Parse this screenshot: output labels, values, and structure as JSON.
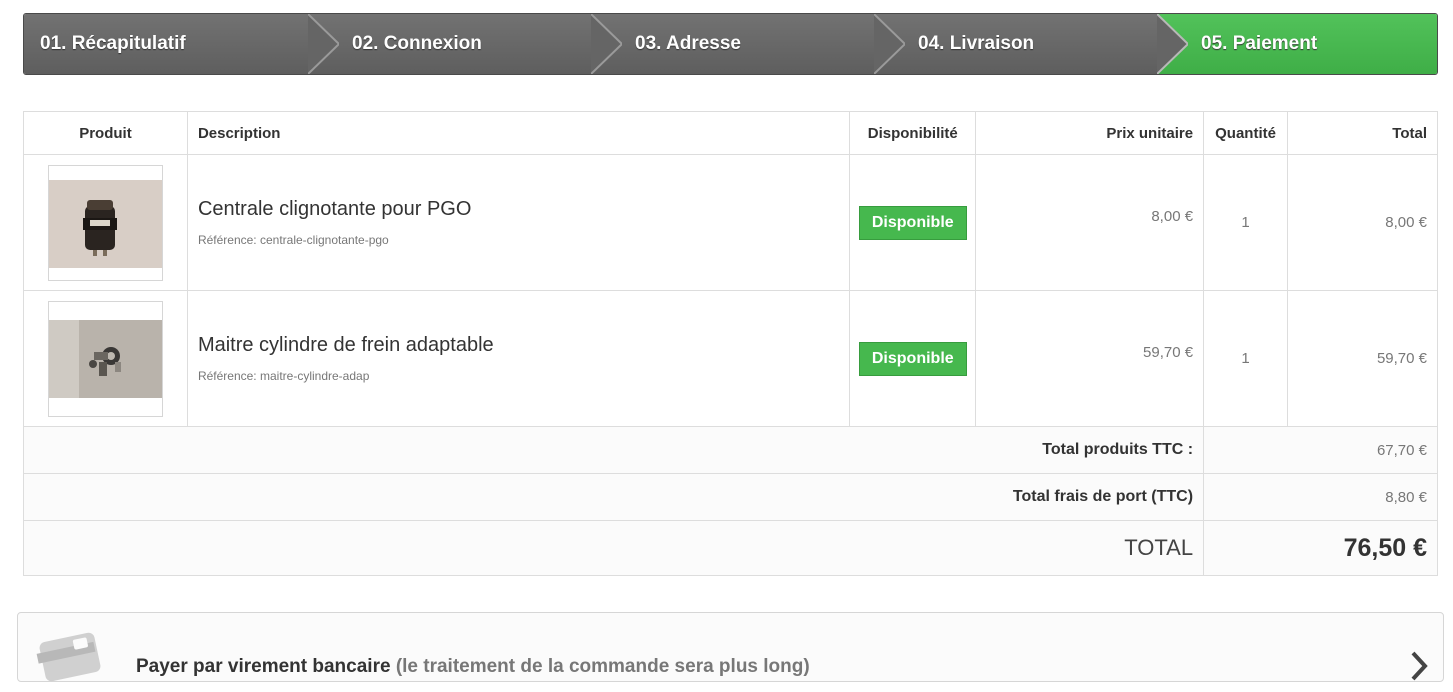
{
  "steps": [
    {
      "label": "01. Récapitulatif"
    },
    {
      "label": "02. Connexion"
    },
    {
      "label": "03. Adresse"
    },
    {
      "label": "04. Livraison"
    },
    {
      "label": "05. Paiement"
    }
  ],
  "active_step": 4,
  "colors": {
    "step_default": "#666666",
    "step_active": "#46b84e",
    "badge_green": "#46b84e"
  },
  "table": {
    "headers": {
      "product": "Produit",
      "description": "Description",
      "availability": "Disponibilité",
      "unit_price": "Prix unitaire",
      "quantity": "Quantité",
      "total": "Total"
    },
    "rows": [
      {
        "name": "Centrale clignotante pour PGO",
        "ref_label": "Référence:",
        "ref": "centrale-clignotante-pgo",
        "availability": "Disponible",
        "unit_price": "8,00 €",
        "quantity": "1",
        "total": "8,00 €"
      },
      {
        "name": "Maitre cylindre de frein adaptable",
        "ref_label": "Référence:",
        "ref": "maitre-cylindre-adap",
        "availability": "Disponible",
        "unit_price": "59,70 €",
        "quantity": "1",
        "total": "59,70 €"
      }
    ],
    "totals": {
      "products_label": "Total produits TTC :",
      "products_value": "67,70 €",
      "shipping_label": "Total frais de port (TTC)",
      "shipping_value": "8,80 €",
      "grand_label": "TOTAL",
      "grand_value": "76,50 €"
    }
  },
  "payment": {
    "label": "Payer par virement bancaire",
    "note": "(le traitement de la commande sera plus long)",
    "icon": "bank-card-icon"
  }
}
